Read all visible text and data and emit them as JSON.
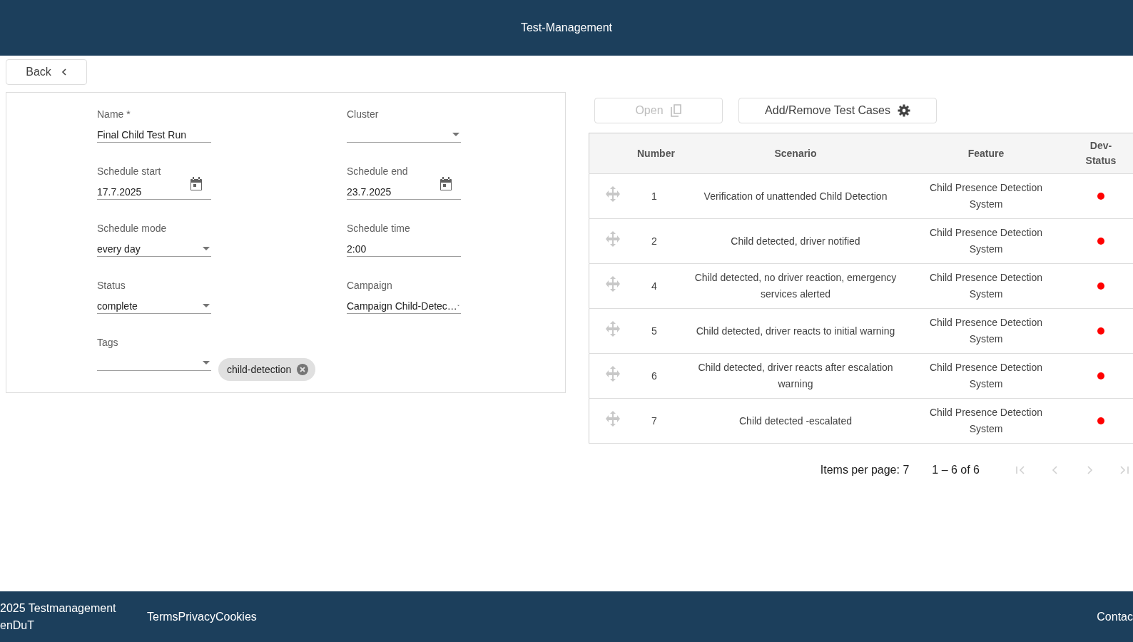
{
  "header": {
    "title": "Test-Management"
  },
  "back_button": {
    "label": "Back"
  },
  "form": {
    "fields": [
      {
        "label": "Name *",
        "kind": "text",
        "value": "Final Child Test Run"
      },
      {
        "label": "Cluster",
        "kind": "select"
      },
      {
        "label": "Schedule start",
        "kind": "date",
        "value": "17.7.2025"
      },
      {
        "label": "Schedule end",
        "kind": "date",
        "value": "23.7.2025"
      },
      {
        "label": "Schedule mode",
        "kind": "select",
        "value": "every day"
      },
      {
        "label": "Schedule time",
        "kind": "text",
        "value": "2:00"
      },
      {
        "label": "Status",
        "kind": "select",
        "value": "complete"
      },
      {
        "label": "Campaign",
        "kind": "select",
        "value": "Campaign Child-Detec…"
      },
      {
        "label": "Tags",
        "kind": "select",
        "chips": [
          "child-detection"
        ]
      }
    ]
  },
  "toolbar": {
    "buttons": [
      {
        "label": "Open",
        "kind": "open",
        "disabled": true
      },
      {
        "label": "Add/Remove Test Cases",
        "kind": "manage",
        "disabled": false
      }
    ]
  },
  "table": {
    "columns": [
      "Number",
      "Scenario",
      "Feature",
      "Dev-Status"
    ],
    "rows": [
      {
        "number": "1",
        "scenario": "Verification of unattended Child Detection",
        "feature": "Child Presence Detection System",
        "color": "#ff0000"
      },
      {
        "number": "2",
        "scenario": "Child detected, driver notified",
        "feature": "Child Presence Detection System",
        "color": "#ff0000"
      },
      {
        "number": "4",
        "scenario": "Child detected, no driver reaction, emergency services alerted",
        "feature": "Child Presence Detection System",
        "color": "#ff0000"
      },
      {
        "number": "5",
        "scenario": "Child detected, driver reacts to initial warning",
        "feature": "Child Presence Detection System",
        "color": "#ff0000"
      },
      {
        "number": "6",
        "scenario": "Child detected, driver reacts after escalation warning",
        "feature": "Child Presence Detection System",
        "color": "#ff0000"
      },
      {
        "number": "7",
        "scenario": "Child detected -escalated",
        "feature": "Child Presence Detection System",
        "color": "#ff0000"
      }
    ]
  },
  "paginator": {
    "items_per_page": "Items per page: 7",
    "range": "1 – 6 of 6",
    "first_disabled": true,
    "prev_disabled": true,
    "next_disabled": true,
    "last_disabled": true
  },
  "footer": {
    "copyright": "2025 Testmanagement",
    "owner": "enDuT",
    "links": [
      "Terms",
      "Privacy",
      "Cookies"
    ],
    "contact": "Contac"
  }
}
